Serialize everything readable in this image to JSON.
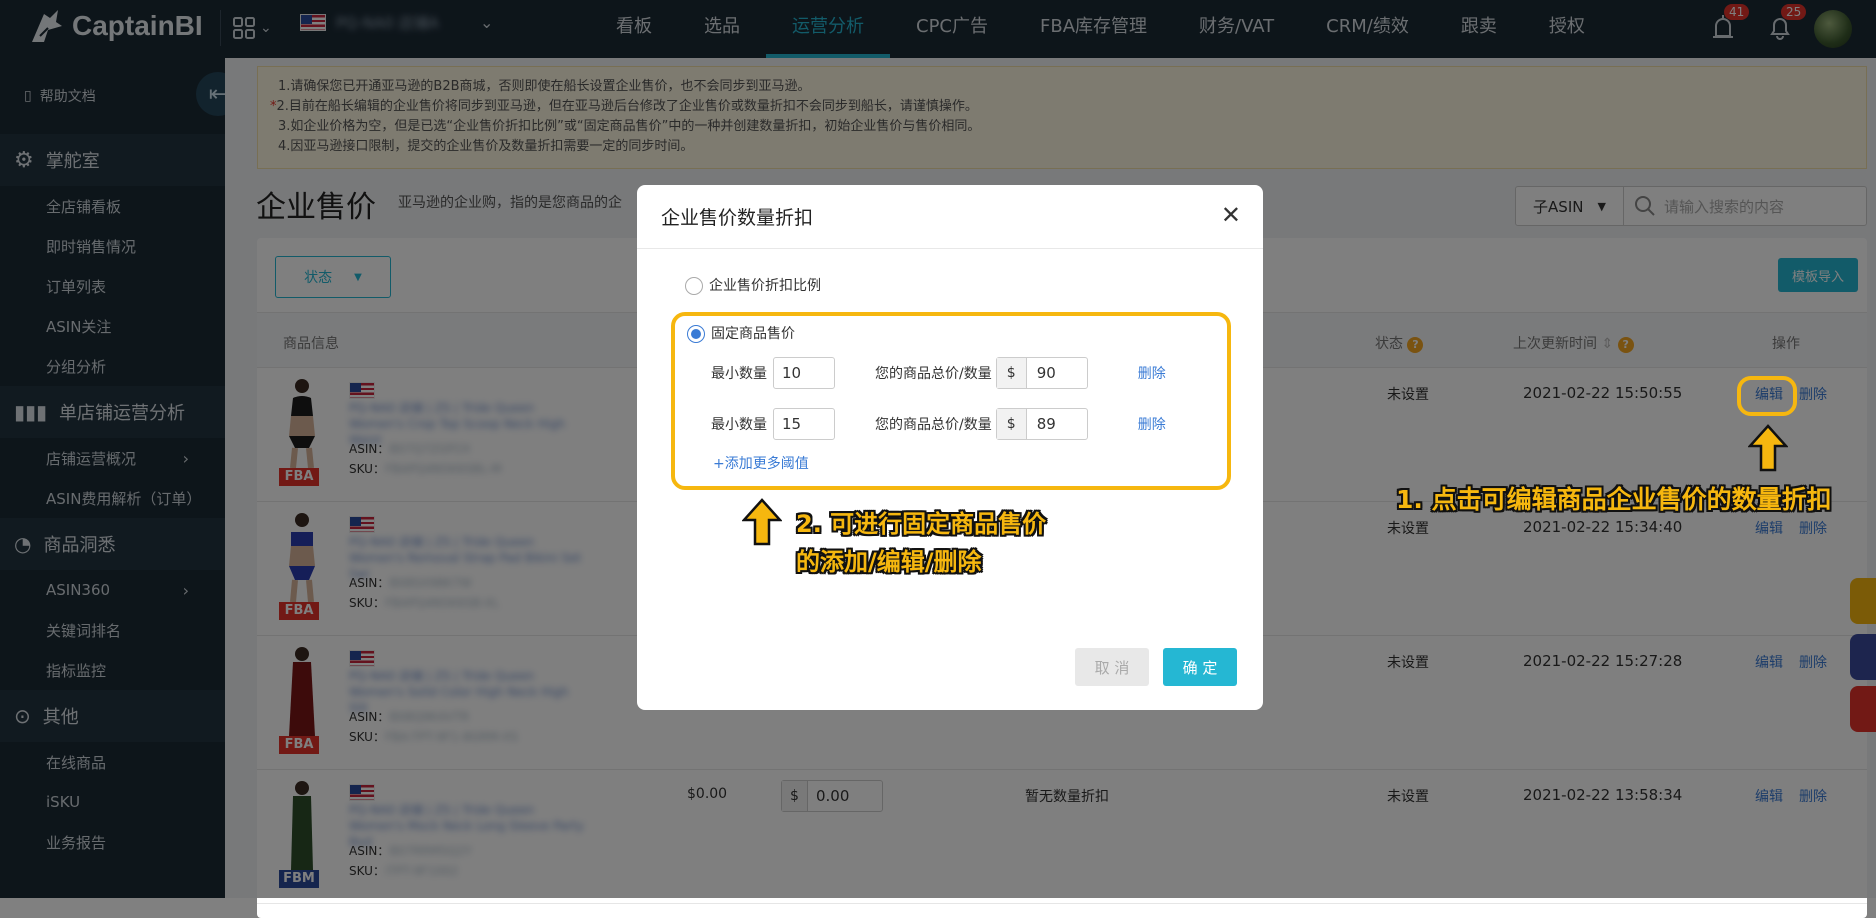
{
  "app": {
    "name": "CaptainBI",
    "store_name": "PQ-NA0 店铺A",
    "avatar": "avatar"
  },
  "topnav": {
    "items": [
      "看板",
      "选品",
      "运营分析",
      "CPC广告",
      "FBA库存管理",
      "财务/VAT",
      "CRM/绩效",
      "跟卖",
      "授权"
    ],
    "active": "运营分析",
    "alert_count": "41",
    "notice_count": "25"
  },
  "sidebar": {
    "help": "帮助文档",
    "groups": [
      {
        "label": "掌舵室",
        "icon": "gear-icon",
        "items": [
          "全店铺看板",
          "即时销售情况",
          "订单列表",
          "ASIN关注",
          "分组分析"
        ]
      },
      {
        "label": "单店铺运营分析",
        "icon": "bar-chart-icon",
        "items": [
          "店铺运营概况",
          "ASIN费用解析（订单）"
        ]
      },
      {
        "label": "商品洞悉",
        "icon": "pie-icon",
        "items": [
          "ASIN360",
          "关键词排名",
          "指标监控"
        ]
      },
      {
        "label": "其他",
        "icon": "more-icon",
        "items": [
          "在线商品",
          "iSKU",
          "业务报告"
        ]
      }
    ]
  },
  "notice": {
    "lines": [
      "1.请确保您已开通亚马逊的B2B商城，否则即使在船长设置企业售价，也不会同步到亚马逊。",
      "2.目前在船长编辑的企业售价将同步到亚马逊，但在亚马逊后台修改了企业售价或数量折扣不会同步到船长，请谨慎操作。",
      "3.如企业价格为空，但是已选“企业售价折扣比例”或“固定商品售价”中的一种并创建数量折扣，初始企业售价与售价相同。",
      "4.因亚马逊接口限制，提交的企业售价及数量折扣需要一定的同步时间。"
    ]
  },
  "page": {
    "title": "企业售价",
    "subtitle": "亚马逊的企业购，指的是您商品的企",
    "asin_select": "子ASIN",
    "search_placeholder": "请输入搜索的内容",
    "status_button": "状态",
    "template_import": "模板导入"
  },
  "table": {
    "headers": {
      "product": "商品信息",
      "status": "状态",
      "updated": "上次更新时间",
      "actions": "操作"
    },
    "rows": [
      {
        "fulfillment": "FBA",
        "asin_label": "ASIN：",
        "sku_label": "SKU：",
        "asin": "B07Q7ZGP2X",
        "sku": "FBAPQ4N5K6SBL-M",
        "title": "PQ-NA0 店铺 | ZS | Tride Queen Women's Crop Top Scoop Neck High Waist",
        "status": "未设置",
        "updated": "2021-02-22 15:50:55",
        "edit": "编辑",
        "delete": "删除",
        "price": "",
        "price_input": "",
        "discount": "",
        "color": "#1c1c1c"
      },
      {
        "fulfillment": "FBA",
        "asin_label": "ASIN：",
        "sku_label": "SKU：",
        "asin": "B08SX9BK7W",
        "sku": "FBAPQ4N5K6SB-XL",
        "title": "PQ-NA0 店铺 | ZS | Tride Queen Women's Removal Strap Pad Bikini Set Swi",
        "status": "未设置",
        "updated": "2021-02-22 15:34:40",
        "edit": "编辑",
        "delete": "删除",
        "price": "",
        "price_input": "",
        "discount": "",
        "color": "#2b3cb0"
      },
      {
        "fulfillment": "FBA",
        "asin_label": "ASIN：",
        "sku_label": "SKU：",
        "asin": "B08Q9K4VTR",
        "sku": "FBA-TPT-9F1-8GRM-XS",
        "title": "PQ-NA0 店铺 | ZS | Tride Queen Women's Solid Color High Neck High Slit",
        "status": "未设置",
        "updated": "2021-02-22 15:27:28",
        "edit": "编辑",
        "delete": "删除",
        "price": "",
        "price_input": "",
        "discount": "",
        "color": "#7a1616"
      },
      {
        "fulfillment": "FBM",
        "asin_label": "ASIN：",
        "sku_label": "SKU：",
        "asin": "B07RRM5Q2Y",
        "sku": "iTPT-9F1002",
        "title": "PQ-NA0 店铺 | ZS | Tride Queen Women's Mock Neck Long Sleeve Party Bod",
        "status": "未设置",
        "updated": "2021-02-22 13:58:34",
        "edit": "编辑",
        "delete": "删除",
        "price": "$0.00",
        "price_input": "0.00",
        "discount": "暂无数量折扣",
        "color": "#2f4f2a"
      }
    ]
  },
  "modal": {
    "title": "企业售价数量折扣",
    "option_ratio": "企业售价折扣比例",
    "option_fixed": "固定商品售价",
    "selected": "固定商品售价",
    "tiers": [
      {
        "min_label": "最小数量",
        "min_qty": "10",
        "price_label": "您的商品总价/数量",
        "currency": "$",
        "price": "90",
        "delete": "删除"
      },
      {
        "min_label": "最小数量",
        "min_qty": "15",
        "price_label": "您的商品总价/数量",
        "currency": "$",
        "price": "89",
        "delete": "删除"
      }
    ],
    "add_more": "+添加更多阈值",
    "cancel": "取 消",
    "confirm": "确 定"
  },
  "annotations": {
    "step1": "1. 点击可编辑商品企业售价的数量折扣",
    "step2_line1": "2. 可进行固定商品售价",
    "step2_line2": "的添加/编辑/删除",
    "highlight_color": "#f6b70f"
  }
}
